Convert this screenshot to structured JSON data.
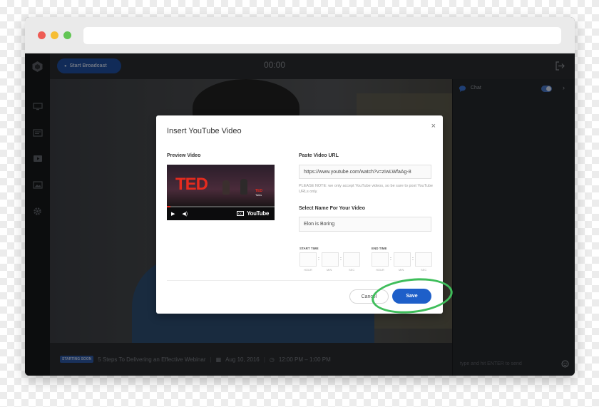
{
  "app": {
    "start_broadcast_label": "Start Broadcast",
    "timer": "00:00"
  },
  "chat": {
    "label": "Chat",
    "input_placeholder": "type and hit ENTER to send",
    "enabled": true
  },
  "webinar": {
    "badge": "STARTING SOON",
    "title": "5 Steps To Delivering an Effective Webinar",
    "date": "Aug 10, 2016",
    "time": "12:00 PM – 1:00 PM"
  },
  "modal": {
    "title": "Insert YouTube Video",
    "close_glyph": "×",
    "preview_label": "Preview Video",
    "url_label": "Paste Video URL",
    "url_value": "https://www.youtube.com/watch?v=zIwLWfaAg-8",
    "note": "PLEASE NOTE: we only accept YouTube videos, so be sure to post YouTube URLs only.",
    "name_label": "Select Name For Your Video",
    "name_value": "Elon is Boring",
    "start_time_label": "START TIME",
    "end_time_label": "END TIME",
    "time_units": [
      "HOUR",
      "MIN",
      "SEC"
    ],
    "cancel_label": "Cancel",
    "save_label": "Save",
    "video": {
      "brand_text": "TED",
      "brand_small": "TED",
      "brand_sub": "Talks",
      "player_logo": "YouTube",
      "cc_text": "CC"
    }
  },
  "colors": {
    "accent": "#1e5fc9",
    "highlight": "#3fbe5b",
    "ted_red": "#e62b1e"
  }
}
